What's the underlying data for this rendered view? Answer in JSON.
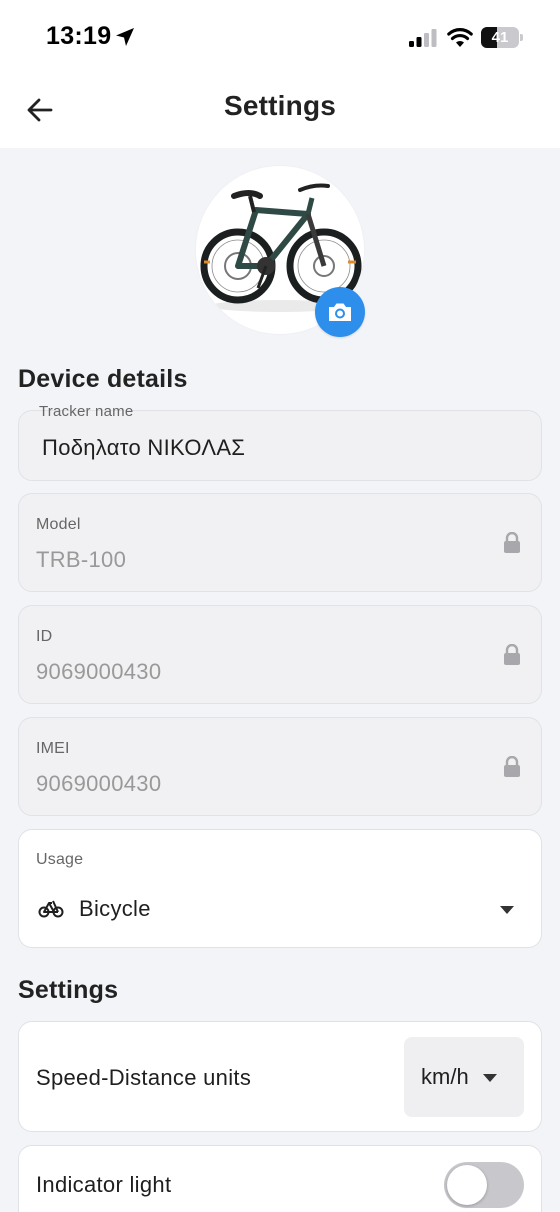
{
  "status_bar": {
    "time": "13:19",
    "battery_level": "41",
    "battery_percent": 41
  },
  "app_bar": {
    "title": "Settings",
    "back_icon": "arrow-left-icon"
  },
  "device_image": {
    "camera_icon": "camera-icon"
  },
  "device_details": {
    "heading": "Device details",
    "tracker_name": {
      "label": "Tracker name",
      "value": "Ποδηλατο ΝΙΚΟΛΑΣ"
    },
    "model": {
      "label": "Model",
      "value": "TRB-100",
      "icon": "lock-icon"
    },
    "id": {
      "label": "ID",
      "value": "9069000430",
      "icon": "lock-icon"
    },
    "imei": {
      "label": "IMEI",
      "value": "9069000430",
      "icon": "lock-icon"
    },
    "usage": {
      "label": "Usage",
      "value": "Bicycle",
      "icon": "bicycle-icon"
    }
  },
  "settings": {
    "heading": "Settings",
    "speed_distance": {
      "label": "Speed-Distance units",
      "value": "km/h"
    },
    "indicator_light": {
      "label": "Indicator light",
      "enabled": false
    }
  },
  "colors": {
    "accent": "#2E8EEB",
    "background": "#F2F4F8",
    "locked_field": "#F1F1F3"
  }
}
